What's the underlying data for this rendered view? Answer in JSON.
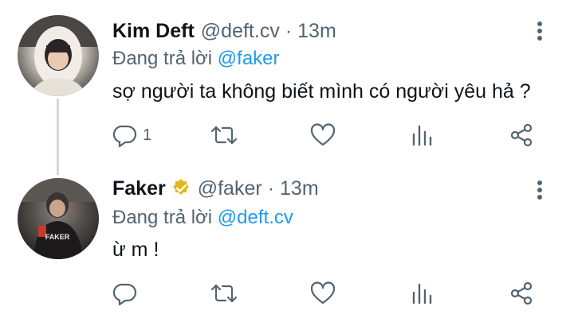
{
  "tweets": [
    {
      "name": "Kim Deft",
      "handle": "@deft.cv",
      "separator": "·",
      "time": "13m",
      "reply_prefix": "Đang trả lời",
      "reply_to": "@faker",
      "text": "sợ người ta không biết mình có người yêu hả ?",
      "reply_count": "1",
      "verified": false
    },
    {
      "name": "Faker",
      "handle": "@faker",
      "separator": "·",
      "time": "13m",
      "reply_prefix": "Đang trả lời",
      "reply_to": "@deft.cv",
      "text": "ừ m !",
      "reply_count": "",
      "verified": true,
      "jersey_text": "FAKER"
    }
  ],
  "colors": {
    "text_primary": "#0f1419",
    "text_secondary": "#536471",
    "link": "#1d9bf0",
    "verified_badge": "#e2b719",
    "thread_line": "#cfd9de"
  },
  "icons": [
    "reply-icon",
    "retweet-icon",
    "like-icon",
    "views-icon",
    "share-icon",
    "more-options-icon",
    "verified-badge-icon"
  ]
}
